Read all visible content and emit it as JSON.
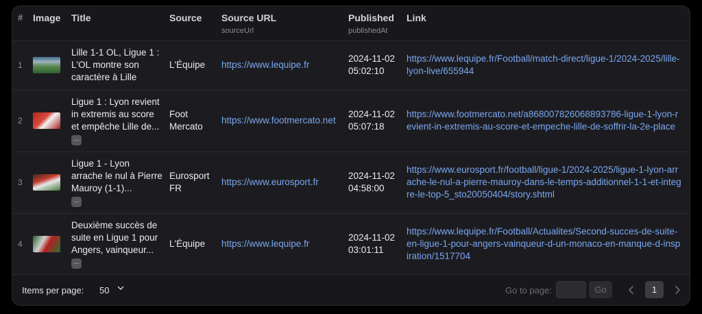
{
  "columns": {
    "num": "#",
    "image": "Image",
    "title": "Title",
    "source": "Source",
    "source_url": "Source URL",
    "source_url_sub": "sourceUrl",
    "published": "Published",
    "published_sub": "publishedAt",
    "link": "Link"
  },
  "rows": [
    {
      "num": "1",
      "image_icon": "match-photo-thumbnail",
      "title": "Lille 1-1 OL, Ligue 1 : L'OL montre son caractère à Lille",
      "truncated": false,
      "source": "L'Équipe",
      "source_url": "https://www.lequipe.fr",
      "published": "2024-11-02 05:02:10",
      "link": "https://www.lequipe.fr/Football/match-direct/ligue-1/2024-2025/lille-lyon-live/655944"
    },
    {
      "num": "2",
      "image_icon": "match-photo-thumbnail",
      "title": "Ligue 1 : Lyon revient in extremis au score et empêche Lille de...",
      "truncated": true,
      "source": "Foot Mercato",
      "source_url": "https://www.footmercato.net",
      "published": "2024-11-02 05:07:18",
      "link": "https://www.footmercato.net/a868007826068893786-ligue-1-lyon-revient-in-extremis-au-score-et-empeche-lille-de-soffrir-la-2e-place"
    },
    {
      "num": "3",
      "image_icon": "match-photo-thumbnail",
      "title": "Ligue 1 - Lyon arrache le nul à Pierre Mauroy (1-1)...",
      "truncated": true,
      "source": "Eurosport FR",
      "source_url": "https://www.eurosport.fr",
      "published": "2024-11-02 04:58:00",
      "link": "https://www.eurosport.fr/football/ligue-1/2024-2025/ligue-1-lyon-arrache-le-nul-a-pierre-mauroy-dans-le-temps-additionnel-1-1-et-integre-le-top-5_sto20050404/story.shtml"
    },
    {
      "num": "4",
      "image_icon": "match-photo-thumbnail",
      "title": "Deuxième succès de suite en Ligue 1 pour Angers, vainqueur...",
      "truncated": true,
      "source": "L'Équipe",
      "source_url": "https://www.lequipe.fr",
      "published": "2024-11-02 03:01:11",
      "link": "https://www.lequipe.fr/Football/Actualites/Second-succes-de-suite-en-ligue-1-pour-angers-vainqueur-d-un-monaco-en-manque-d-inspiration/1517704"
    }
  ],
  "more_glyph": "···",
  "footer": {
    "items_per_page_label": "Items per page:",
    "items_per_page_value": "50",
    "goto_label": "Go to page:",
    "go_button": "Go",
    "current_page": "1"
  },
  "colors": {
    "background": "#000000",
    "panel": "#18181b",
    "link": "#7aa7f0",
    "text": "#ececef",
    "muted": "#8b8b93"
  }
}
